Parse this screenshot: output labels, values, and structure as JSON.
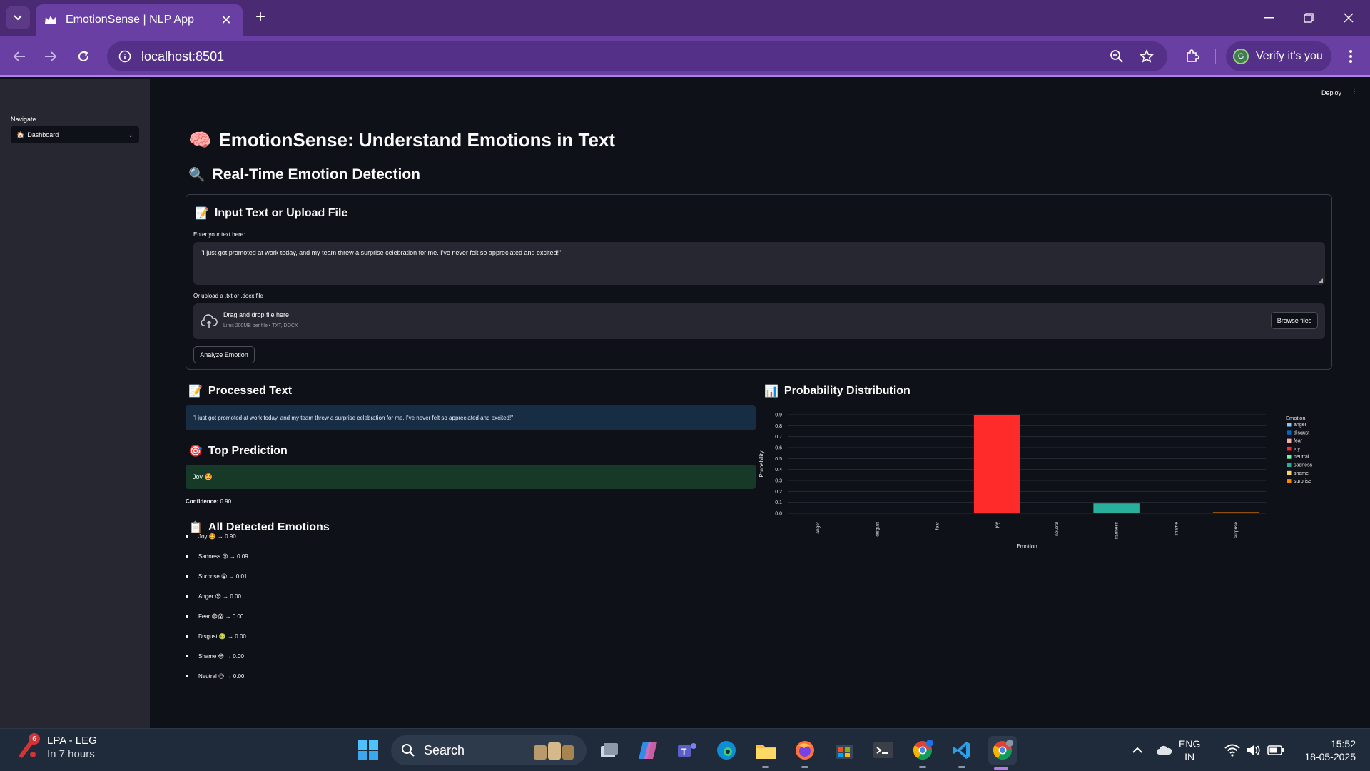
{
  "browser": {
    "tab_title": "EmotionSense | NLP App",
    "url": "localhost:8501",
    "profile_initial": "G",
    "profile_label": "Verify it's you"
  },
  "header": {
    "deploy_label": "Deploy"
  },
  "sidebar": {
    "nav_label": "Navigate",
    "selected_page": "Dashboard"
  },
  "main": {
    "title": "EmotionSense: Understand Emotions in Text",
    "subtitle": "Real-Time Emotion Detection",
    "input_heading": "Input Text or Upload File",
    "text_label": "Enter your text here:",
    "text_value": "\"I just got promoted at work today, and my team threw a surprise celebration for me. I've never felt so appreciated and excited!\"",
    "upload_label": "Or upload a .txt or .docx file",
    "drop_title": "Drag and drop file here",
    "drop_limit": "Limit 200MB per file • TXT, DOCX",
    "browse_label": "Browse files",
    "analyze_label": "Analyze Emotion",
    "processed_heading": "Processed Text",
    "processed_text": "\"I just got promoted at work today, and my team threw a surprise celebration for me. I've never felt so appreciated and excited!\"",
    "top_heading": "Top Prediction",
    "top_prediction": "Joy 🤩",
    "confidence_label": "Confidence:",
    "confidence_value": "0.90",
    "all_heading": "All Detected Emotions",
    "emotions": [
      {
        "text": "Joy 🤩 → 0.90"
      },
      {
        "text": "Sadness 😢 → 0.09"
      },
      {
        "text": "Surprise 😲 → 0.01"
      },
      {
        "text": "Anger 😠 → 0.00"
      },
      {
        "text": "Fear 😨😱 → 0.00"
      },
      {
        "text": "Disgust 🤢 → 0.00"
      },
      {
        "text": "Shame 😳 → 0.00"
      },
      {
        "text": "Neutral 😐 → 0.00"
      }
    ],
    "chart_heading": "Probability Distribution"
  },
  "chart_data": {
    "type": "bar",
    "categories": [
      "anger",
      "disgust",
      "fear",
      "joy",
      "neutral",
      "sadness",
      "shame",
      "surprise"
    ],
    "values": [
      0.002,
      0.0005,
      0.002,
      0.9,
      0.0005,
      0.09,
      0.0005,
      0.01
    ],
    "colors": [
      "#83c9ff",
      "#0068c9",
      "#ffabab",
      "#ff2b2b",
      "#7defa1",
      "#29b09d",
      "#ffd16a",
      "#ff8700"
    ],
    "xlabel": "Emotion",
    "ylabel": "Probability",
    "ylim": [
      0,
      0.9
    ],
    "yticks": [
      "0.0",
      "0.1",
      "0.2",
      "0.3",
      "0.4",
      "0.5",
      "0.6",
      "0.7",
      "0.8",
      "0.9"
    ],
    "legend_title": "Emotion",
    "legend_position": "right",
    "grid": true
  },
  "taskbar": {
    "weather_badge": "6",
    "weather_title": "LPA - LEG",
    "weather_sub": "In 7 hours",
    "search_label": "Search",
    "lang_top": "ENG",
    "lang_bottom": "IN",
    "time": "15:52",
    "date": "18-05-2025"
  },
  "colors": {
    "chrome_tabstrip": "#4a2a73",
    "chrome_toolbar": "#6a3fa3",
    "app_bg": "#0e1117",
    "sidebar_bg": "#262730",
    "info_bg": "#172d43",
    "success_bg": "#173928"
  }
}
